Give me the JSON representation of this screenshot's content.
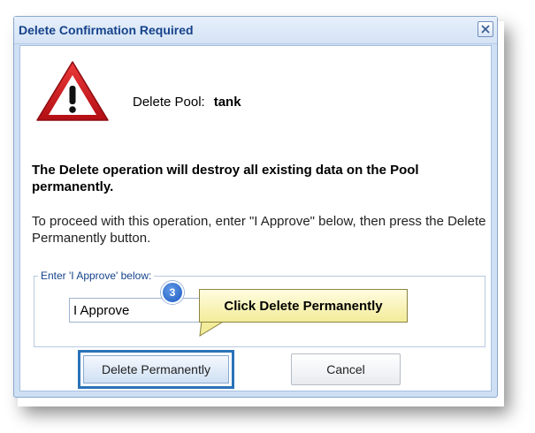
{
  "dialog": {
    "title": "Delete Confirmation Required",
    "pool_label": "Delete Pool:",
    "pool_name": "tank",
    "warning": "The Delete operation will destroy all existing data on the Pool permanently.",
    "instructions": "To proceed with this operation, enter \"I Approve\" below, then press the Delete Permanently button.",
    "fieldset_legend": "Enter 'I Approve' below:",
    "approve_input_value": "I Approve",
    "delete_button_label": "Delete Permanently",
    "cancel_button_label": "Cancel"
  },
  "annotation": {
    "step_number": "3",
    "callout_text": "Click Delete Permanently"
  },
  "icons": {
    "warning": "warning-triangle-icon",
    "close": "close-icon"
  },
  "colors": {
    "title_text": "#15428b",
    "warning_red": "#c8151b",
    "highlight_border": "#2a72b8",
    "callout_fill": "#f6f0a8",
    "step_badge": "#1e5cc2"
  }
}
